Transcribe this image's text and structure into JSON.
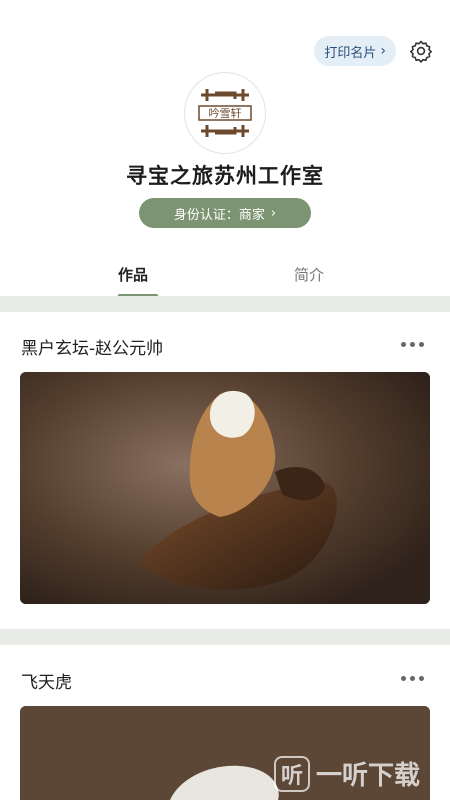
{
  "header": {
    "print_card_label": "打印名片",
    "print_card_icon": "chevron-right-icon",
    "settings_icon": "gear-icon"
  },
  "profile": {
    "logo_text": "吟雪轩",
    "store_name": "寻宝之旅苏州工作室",
    "identity_label": "身份认证：商家",
    "identity_chevron": "›"
  },
  "tabs": [
    {
      "label": "作品",
      "active": true
    },
    {
      "label": "简介",
      "active": false
    }
  ],
  "works": [
    {
      "title": "黑户玄坛-赵公元帅"
    },
    {
      "title": "飞天虎"
    }
  ],
  "watermark": {
    "glyph": "听",
    "text": "一听下载"
  },
  "colors": {
    "accent": "#7d9473",
    "print_bg": "#e4eef7",
    "divider": "#e9ebe7"
  }
}
